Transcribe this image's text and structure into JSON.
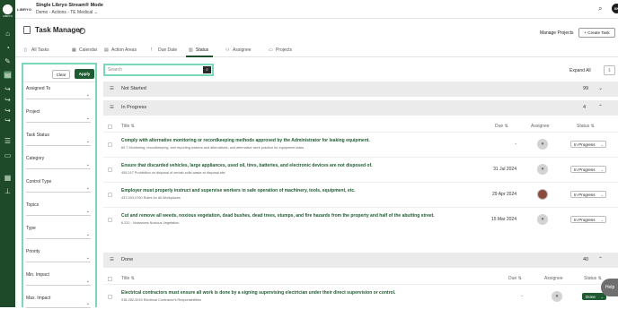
{
  "app": {
    "brand": "LIBRYO",
    "title": "Single Libryo Stream® Mode",
    "subtitle": "Demo - Actions - TE Medical",
    "user_initials": "XN"
  },
  "page": {
    "title": "Task Manager",
    "manage_projects": "Manage Projects",
    "create_task": "+ Create Task"
  },
  "tabs": [
    {
      "label": "All Tasks",
      "icon": "document-icon"
    },
    {
      "label": "Calendar",
      "icon": "calendar-icon"
    },
    {
      "label": "Action Areas",
      "icon": "clipboard-icon"
    },
    {
      "label": "Due Date",
      "icon": "exclamation-icon"
    },
    {
      "label": "Status",
      "icon": "bar-chart-icon"
    },
    {
      "label": "Assignee",
      "icon": "users-icon"
    },
    {
      "label": "Projects",
      "icon": "folder-icon"
    }
  ],
  "filters": {
    "clear": "Clear",
    "apply": "Apply",
    "fields": [
      "Assigned To",
      "Project",
      "Task Status",
      "Category",
      "Control Type",
      "Topics",
      "Type",
      "Priority",
      "Min. Impact",
      "Max. Impact"
    ]
  },
  "search": {
    "placeholder": "Search"
  },
  "expand_all": "Expand All",
  "columns": {
    "title": "Title",
    "due": "Due",
    "assignee": "Assignee",
    "status": "Status"
  },
  "groups": {
    "not_started": {
      "label": "Not Started",
      "count": "99"
    },
    "in_progress": {
      "label": "In Progress",
      "count": "4"
    },
    "done": {
      "label": "Done",
      "count": "40"
    }
  },
  "in_progress_rows": [
    {
      "title": "Comply with alternative monitoring or recordkeeping methods approved by the Administrator for leaking equipment.",
      "sub": "60.7 Monitoring, recordkeeping, and reporting waivers and alternatives, and alternative work practice for equipment leaks",
      "due": "-",
      "status": "In Progress"
    },
    {
      "title": "Ensure that discarded vehicles, large appliances, used oil, tires, batteries, and electronic devices are not disposed of.",
      "sub": "455.247 Prohibition on disposal of certain solid waste at disposal site",
      "due": "31 Jul 2024",
      "status": "In Progress"
    },
    {
      "title": "Employer must properly instruct and supervise workers in safe operation of machinery, tools, equipment, etc.",
      "sub": "437-003-0760 Rules for All Workplaces",
      "due": "29 Apr 2024",
      "status": "In Progress"
    },
    {
      "title": "Cut and remove all weeds, noxious vegetation, dead bushes, dead trees, stumps, and fire hazards from the property and half of the abutting street.",
      "sub": "6.220 - Nuisances Noxious Vegetation",
      "due": "15 Mar 2024",
      "status": "In Progress"
    }
  ],
  "done_rows": [
    {
      "title": "Electrical contractors must ensure all work is done by a signing supervising electrician under their direct supervision or control.",
      "sub": "918-282-0015 Electrical Contractor's Responsibilities",
      "due": "-",
      "status": "Done"
    }
  ],
  "help": "Help"
}
